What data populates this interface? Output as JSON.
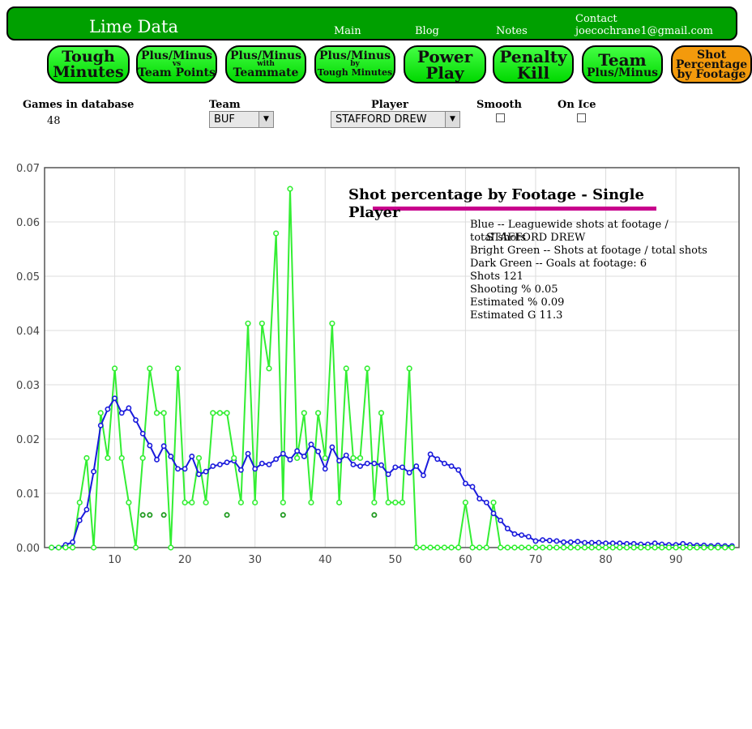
{
  "header": {
    "site_title": "Lime Data",
    "nav": [
      "Main",
      "Blog",
      "Notes"
    ],
    "contact_label": "Contact",
    "contact_email": "joecochrane1@gmail.com"
  },
  "buttons": [
    {
      "lines": [
        "Tough",
        "Minutes"
      ]
    },
    {
      "lines": [
        "Plus/Minus",
        "vs",
        "Team Points"
      ]
    },
    {
      "lines": [
        "Plus/Minus",
        "with",
        "Teammate"
      ]
    },
    {
      "lines": [
        "Plus/Minus",
        "by",
        "Tough Minutes"
      ]
    },
    {
      "lines": [
        "Power",
        "Play"
      ]
    },
    {
      "lines": [
        "Penalty",
        "Kill"
      ]
    },
    {
      "lines": [
        "Team",
        "Plus/Minus"
      ]
    },
    {
      "lines": [
        "Shot",
        "Percentage",
        "by Footage"
      ],
      "active": true
    }
  ],
  "controls": {
    "games_label": "Games in database",
    "games_value": "48",
    "team_label": "Team",
    "team_value": "BUF",
    "player_label": "Player",
    "player_value": "STAFFORD DREW",
    "smooth_label": "Smooth",
    "onice_label": "On Ice"
  },
  "legend": {
    "line1": "Blue -- Leaguewide shots at footage /",
    "line2a": "total shots",
    "line2b": "STAFFORD DREW",
    "line3": "Bright Green -- Shots at footage / total shots",
    "line4": "Dark Green -- Goals at footage: 6",
    "line5": "Shots 121",
    "line6": "Shooting % 0.05",
    "line7": "Estimated % 0.09",
    "line8": "Estimated G 11.3"
  },
  "colors": {
    "blue": "#1a1adc",
    "bright_green": "#33ee33",
    "dark_green": "#1f9a1f",
    "accent": "#c8008c"
  },
  "chart_data": {
    "type": "line",
    "title": "Shot percentage by Footage - Single Player",
    "x": [
      1,
      2,
      3,
      4,
      5,
      6,
      7,
      8,
      9,
      10,
      11,
      12,
      13,
      14,
      15,
      16,
      17,
      18,
      19,
      20,
      21,
      22,
      23,
      24,
      25,
      26,
      27,
      28,
      29,
      30,
      31,
      32,
      33,
      34,
      35,
      36,
      37,
      38,
      39,
      40,
      41,
      42,
      43,
      44,
      45,
      46,
      47,
      48,
      49,
      50,
      51,
      52,
      53,
      54,
      55,
      56,
      57,
      58,
      59,
      60,
      61,
      62,
      63,
      64,
      65,
      66,
      67,
      68,
      69,
      70,
      71,
      72,
      73,
      74,
      75,
      76,
      77,
      78,
      79,
      80,
      81,
      82,
      83,
      84,
      85,
      86,
      87,
      88,
      89,
      90,
      91,
      92,
      93,
      94,
      95,
      96,
      97,
      98
    ],
    "xlim": [
      0,
      99
    ],
    "ylim": [
      0,
      0.07
    ],
    "xticks": [
      10,
      20,
      30,
      40,
      50,
      60,
      70,
      80,
      90
    ],
    "yticks": [
      "0.00",
      "0.01",
      "0.02",
      "0.03",
      "0.04",
      "0.05",
      "0.06",
      "0.07"
    ],
    "grid": true,
    "series": [
      {
        "name": "Blue -- Leaguewide shots at footage / total shots",
        "color": "#1a1adc",
        "values": [
          0,
          0,
          0.0005,
          0.001,
          0.005,
          0.007,
          0.014,
          0.0225,
          0.0255,
          0.0275,
          0.0248,
          0.0257,
          0.0235,
          0.021,
          0.0188,
          0.0162,
          0.0187,
          0.0168,
          0.0145,
          0.0145,
          0.0168,
          0.0135,
          0.014,
          0.015,
          0.0153,
          0.0157,
          0.016,
          0.0143,
          0.0173,
          0.0145,
          0.0155,
          0.0153,
          0.0163,
          0.0173,
          0.0162,
          0.0178,
          0.0168,
          0.019,
          0.0177,
          0.0145,
          0.0185,
          0.016,
          0.017,
          0.0153,
          0.015,
          0.0155,
          0.0155,
          0.0152,
          0.0135,
          0.0148,
          0.0148,
          0.0138,
          0.015,
          0.0133,
          0.0172,
          0.0163,
          0.0155,
          0.015,
          0.0143,
          0.0118,
          0.0112,
          0.009,
          0.0083,
          0.0063,
          0.005,
          0.0035,
          0.0025,
          0.0023,
          0.002,
          0.0012,
          0.0014,
          0.0013,
          0.0012,
          0.001,
          0.001,
          0.0011,
          0.0009,
          0.0009,
          0.0009,
          0.0008,
          0.0008,
          0.0008,
          0.0007,
          0.0007,
          0.0006,
          0.0006,
          0.0008,
          0.0006,
          0.0005,
          0.0005,
          0.0007,
          0.0005,
          0.0004,
          0.0004,
          0.0003,
          0.0004,
          0.0003,
          0.0003
        ]
      },
      {
        "name": "Bright Green -- Shots at footage / total shots",
        "color": "#33ee33",
        "values": [
          0,
          0,
          0,
          0,
          0.0083,
          0.0165,
          0,
          0.0248,
          0.0165,
          0.033,
          0.0165,
          0.0083,
          0,
          0.0165,
          0.033,
          0.0248,
          0.0248,
          0,
          0.033,
          0.0083,
          0.0083,
          0.0165,
          0.0083,
          0.0248,
          0.0248,
          0.0248,
          0.0165,
          0.0083,
          0.0413,
          0.0083,
          0.0413,
          0.033,
          0.0579,
          0.0083,
          0.0661,
          0.0165,
          0.0248,
          0.0083,
          0.0248,
          0.0165,
          0.0413,
          0.0083,
          0.033,
          0.0165,
          0.0165,
          0.033,
          0.0083,
          0.0248,
          0.0083,
          0.0083,
          0.0083,
          0.033,
          0,
          0,
          0,
          0,
          0,
          0,
          0,
          0.0083,
          0,
          0,
          0,
          0.0083,
          0,
          0,
          0,
          0,
          0,
          0,
          0,
          0,
          0,
          0,
          0,
          0,
          0,
          0,
          0,
          0,
          0,
          0,
          0,
          0,
          0,
          0,
          0,
          0,
          0,
          0,
          0,
          0,
          0,
          0,
          0,
          0,
          0,
          0
        ]
      },
      {
        "name": "Dark Green -- Goals at footage: 6",
        "color": "#1f9a1f",
        "points": [
          [
            14,
            0.006
          ],
          [
            15,
            0.006
          ],
          [
            17,
            0.006
          ],
          [
            26,
            0.006
          ],
          [
            34,
            0.006
          ],
          [
            47,
            0.006
          ]
        ]
      }
    ]
  }
}
